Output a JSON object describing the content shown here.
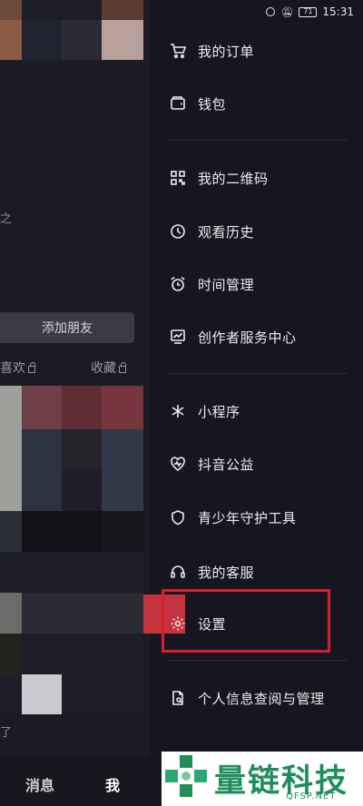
{
  "status_bar": {
    "battery": "71",
    "time": "15:31"
  },
  "background_profile": {
    "add_friend": "添加朋友",
    "tab_likes": "喜欢",
    "tab_favorites": "收藏",
    "fragment_1": "之",
    "fragment_2": "了",
    "bottom_nav": {
      "messages": "消息",
      "me": "我"
    }
  },
  "drawer": {
    "items": [
      {
        "label": "我的订单",
        "icon": "cart-icon"
      },
      {
        "label": "钱包",
        "icon": "wallet-icon"
      },
      {
        "label": "我的二维码",
        "icon": "qr-code-icon"
      },
      {
        "label": "观看历史",
        "icon": "clock-icon"
      },
      {
        "label": "时间管理",
        "icon": "alarm-icon"
      },
      {
        "label": "创作者服务中心",
        "icon": "chart-icon"
      },
      {
        "label": "小程序",
        "icon": "asterisk-icon"
      },
      {
        "label": "抖音公益",
        "icon": "heart-icon"
      },
      {
        "label": "青少年守护工具",
        "icon": "shield-icon"
      },
      {
        "label": "我的客服",
        "icon": "headset-icon"
      },
      {
        "label": "设置",
        "icon": "gear-icon"
      },
      {
        "label": "个人信息查阅与管理",
        "icon": "document-icon"
      }
    ]
  },
  "watermark": {
    "title": "量链科技",
    "subtitle": "QFSP.NET"
  },
  "colors": {
    "drawer_bg": "#15161f",
    "highlight_border": "#d61f2c",
    "watermark_green": "#1e8e5a"
  }
}
